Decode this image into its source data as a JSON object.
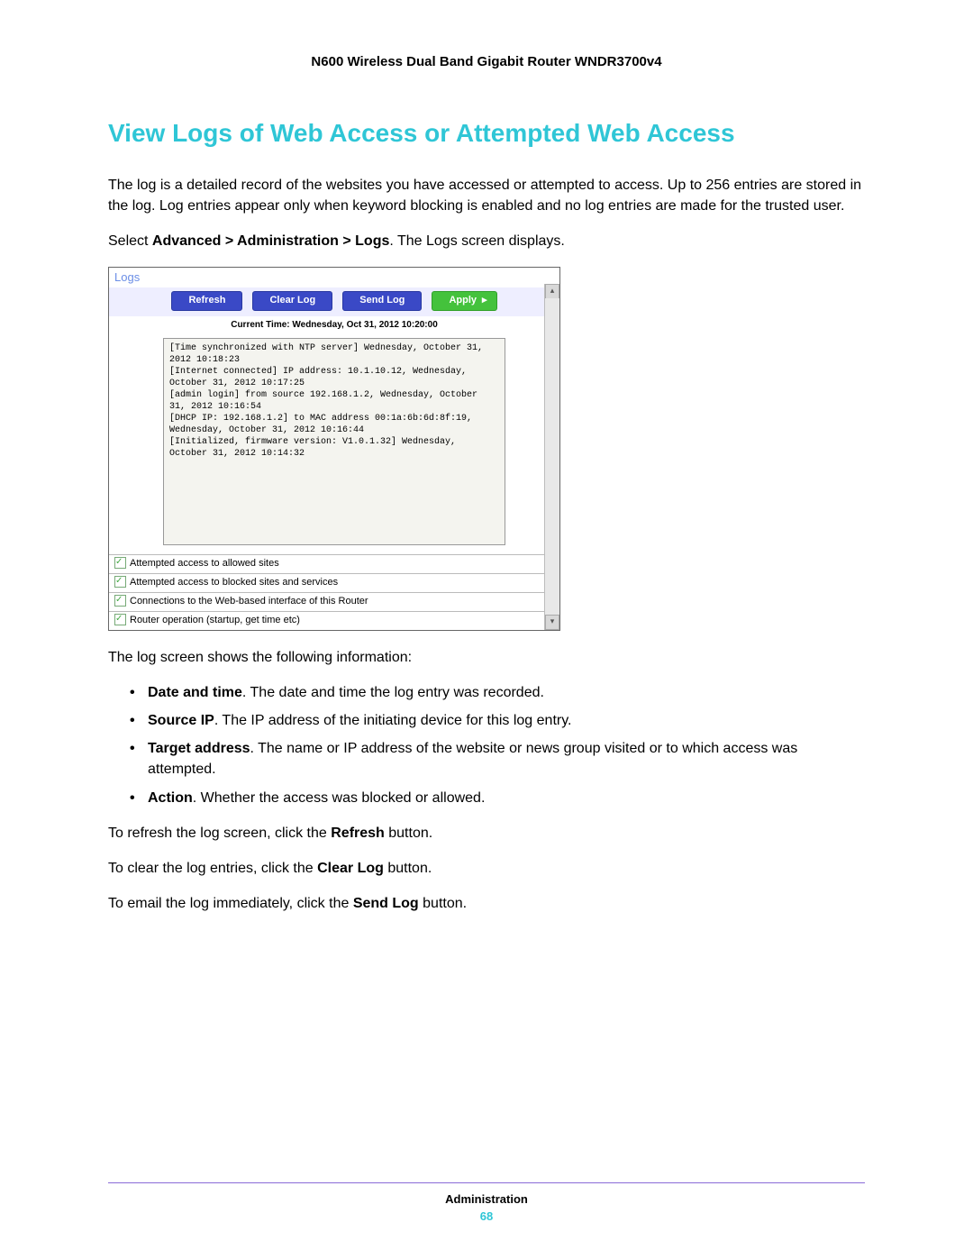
{
  "header": "N600 Wireless Dual Band Gigabit Router WNDR3700v4",
  "title": "View Logs of Web Access or Attempted Web Access",
  "intro": "The log is a detailed record of the websites you have accessed or attempted to access. Up to 256 entries are stored in the log. Log entries appear only when keyword blocking is enabled and no log entries are made for the trusted user.",
  "navline_pre": "Select ",
  "navline_bold": "Advanced > Administration > Logs",
  "navline_post": ". The Logs screen displays.",
  "screenshot": {
    "panel_title": "Logs",
    "buttons": {
      "refresh": "Refresh",
      "clear": "Clear Log",
      "send": "Send Log",
      "apply": "Apply"
    },
    "current_time": "Current Time: Wednesday, Oct 31, 2012 10:20:00",
    "log_text": "[Time synchronized with NTP server] Wednesday, October 31, 2012 10:18:23\n[Internet connected] IP address: 10.1.10.12, Wednesday, October 31, 2012 10:17:25\n[admin login] from source 192.168.1.2, Wednesday, October 31, 2012 10:16:54\n[DHCP IP: 192.168.1.2] to MAC address 00:1a:6b:6d:8f:19, Wednesday, October 31, 2012 10:16:44\n[Initialized, firmware version: V1.0.1.32] Wednesday, October 31, 2012 10:14:32",
    "checks": {
      "c1": "Attempted access to allowed sites",
      "c2": "Attempted access to blocked sites and services",
      "c3": "Connections to the Web-based interface of this Router",
      "c4": "Router operation (startup, get time etc)"
    }
  },
  "after_shot": "The log screen shows the following information:",
  "bullets": {
    "b1_bold": "Date and time",
    "b1": ". The date and time the log entry was recorded.",
    "b2_bold": "Source IP",
    "b2": ". The IP address of the initiating device for this log entry.",
    "b3_bold": "Target address",
    "b3": ". The name or IP address of the website or news group visited or to which access was attempted.",
    "b4_bold": "Action",
    "b4": ". Whether the access was blocked or allowed."
  },
  "para_refresh_pre": "To refresh the log screen, click the ",
  "para_refresh_bold": "Refresh",
  "para_refresh_post": " button.",
  "para_clear_pre": "To clear the log entries, click the ",
  "para_clear_bold": "Clear Log",
  "para_clear_post": " button.",
  "para_send_pre": "To email the log immediately, click the ",
  "para_send_bold": "Send Log",
  "para_send_post": " button.",
  "footer": {
    "section": "Administration",
    "page": "68"
  }
}
